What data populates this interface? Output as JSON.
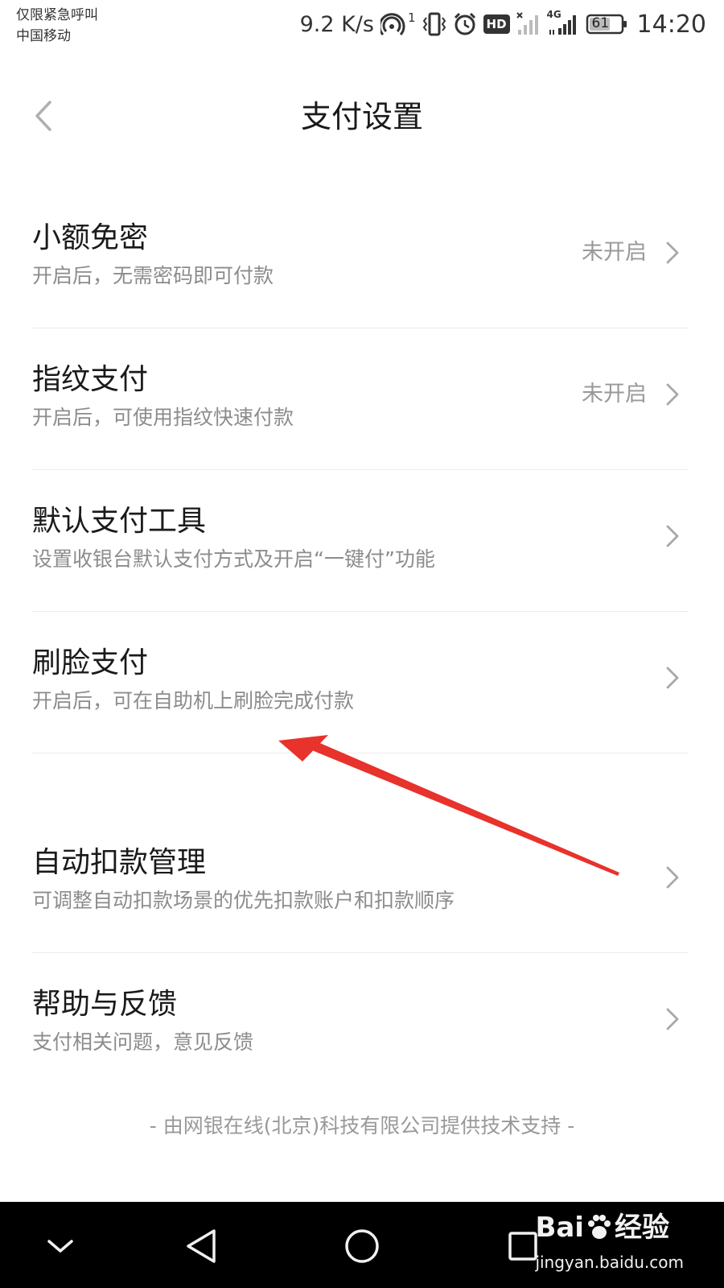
{
  "status_bar": {
    "carrier_line1": "仅限紧急呼叫",
    "carrier_line2": "中国移动",
    "net_speed": "9.2 K/s",
    "hotspot_sup": "1",
    "hd_badge": "HD",
    "network_type": "4G",
    "battery": "61",
    "time": "14:20"
  },
  "header": {
    "title": "支付设置"
  },
  "settings": [
    {
      "title": "小额免密",
      "subtitle": "开启后，无需密码即可付款",
      "status": "未开启"
    },
    {
      "title": "指纹支付",
      "subtitle": "开启后，可使用指纹快速付款",
      "status": "未开启"
    },
    {
      "title": "默认支付工具",
      "subtitle": "设置收银台默认支付方式及开启“一键付”功能",
      "status": ""
    },
    {
      "title": "刷脸支付",
      "subtitle": "开启后，可在自助机上刷脸完成付款",
      "status": ""
    },
    {
      "title": "自动扣款管理",
      "subtitle": "可调整自动扣款场景的优先扣款账户和扣款顺序",
      "status": ""
    },
    {
      "title": "帮助与反馈",
      "subtitle": "支付相关问题，意见反馈",
      "status": ""
    }
  ],
  "footer": {
    "text": "- 由网银在线(北京)科技有限公司提供技术支持 -"
  },
  "watermark": {
    "brand": "Bai",
    "brand_suffix": "经验",
    "url": "jingyan.baidu.com"
  },
  "colors": {
    "annotation_arrow": "#e8322c",
    "nav_bar": "#000000"
  }
}
